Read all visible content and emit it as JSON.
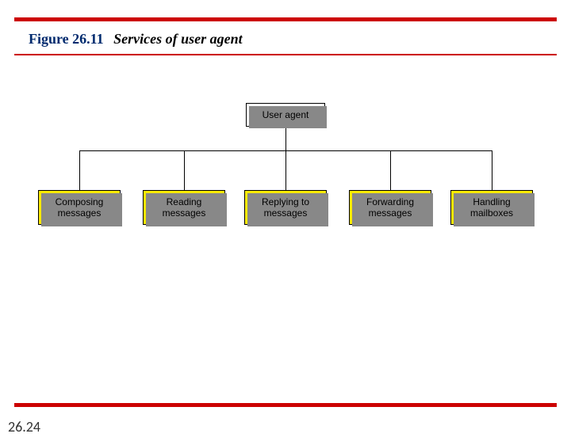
{
  "figure": {
    "label": "Figure 26.11",
    "caption": "Services of user agent"
  },
  "diagram": {
    "root": "User agent",
    "children": [
      "Composing\nmessages",
      "Reading\nmessages",
      "Replying to\nmessages",
      "Forwarding\nmessages",
      "Handling\nmailboxes"
    ]
  },
  "page_number": "26.24"
}
